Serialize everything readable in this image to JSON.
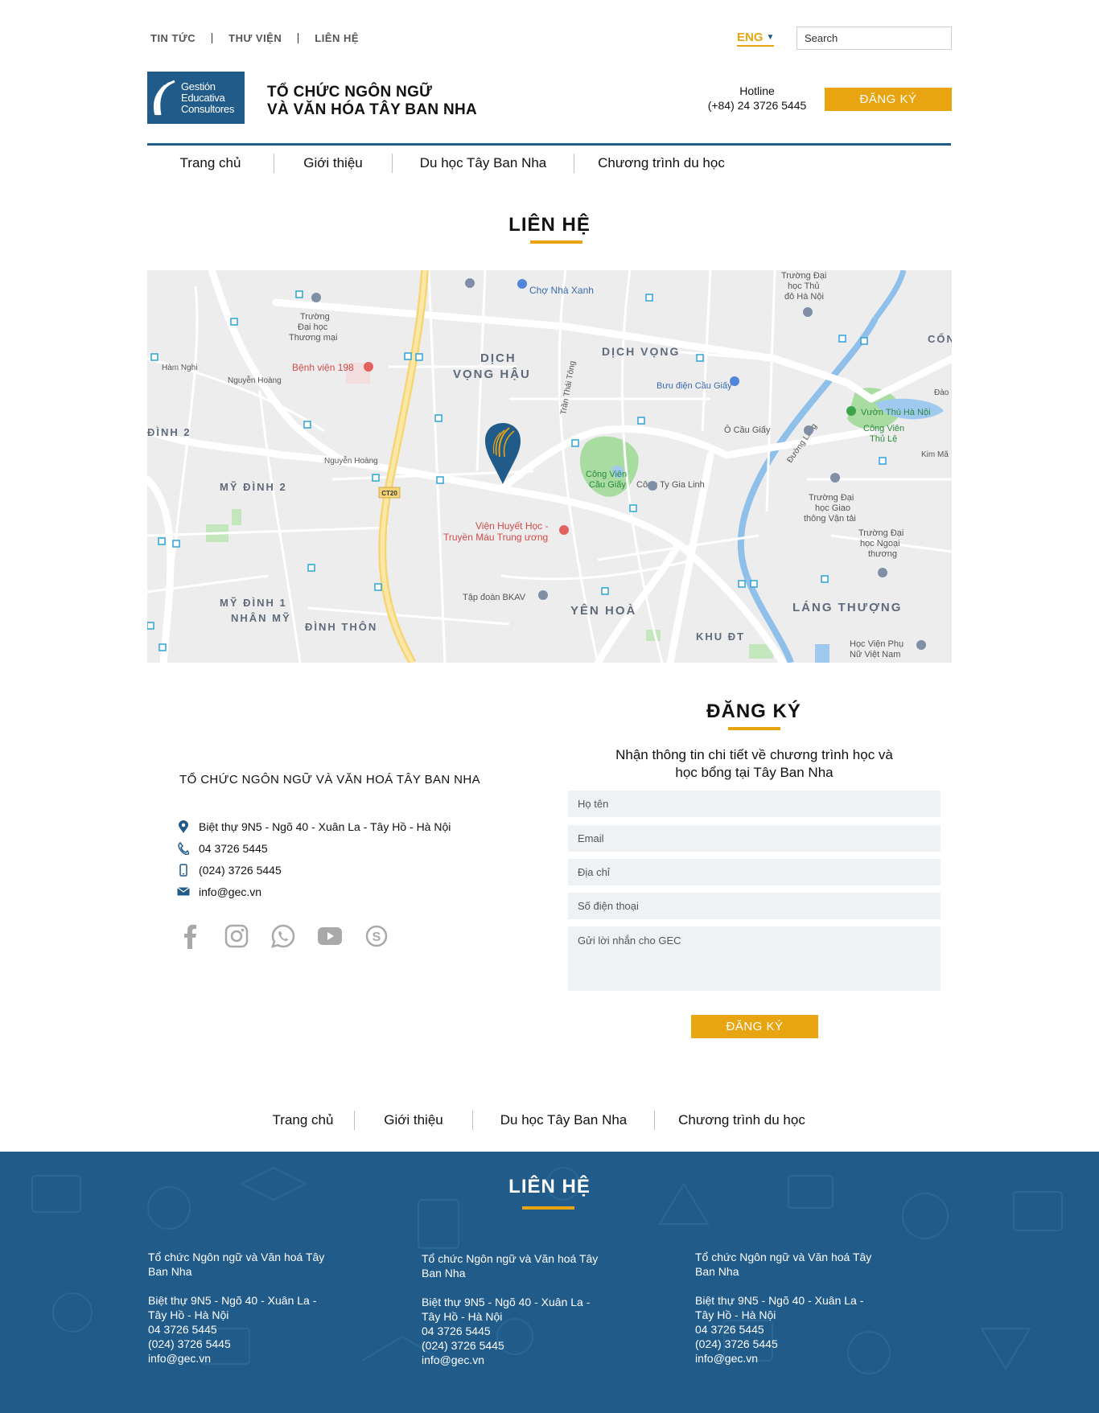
{
  "topbar": {
    "links": [
      "TIN TỨC",
      "THƯ VIỆN",
      "LIÊN HỆ"
    ],
    "language": "ENG",
    "search_placeholder": "Search"
  },
  "header": {
    "logo_lines": [
      "Gestión",
      "Educativa",
      "Consultores"
    ],
    "org_line1": "TỔ CHỨC NGÔN NGỮ",
    "org_line2": "VÀ VĂN HÓA TÂY BAN NHA",
    "hotline_label": "Hotline",
    "hotline_number": "(+84) 24 3726 5445",
    "register_button": "ĐĂNG KÝ"
  },
  "nav": [
    "Trang chủ",
    "Giới thiệu",
    "Du học Tây Ban Nha",
    "Chương trình du học"
  ],
  "page_title": "LIÊN HỆ",
  "map": {
    "labels": {
      "dich_vong_hau_1": "DỊCH",
      "dich_vong_hau_2": "VỌNG HẬU",
      "dich_vong": "DỊCH VỌNG",
      "my_dinh_2": "MỸ ĐÌNH 2",
      "my_dinh_1": "MỸ ĐÌNH 1",
      "nhan_my": "NHÂN MỸ",
      "dinh_thon": "ĐÌNH THÔN",
      "yen_hoa": "YÊN HOÀ",
      "lang_thuong": "LÁNG THƯỢNG",
      "khu_dt": "KHU ĐT",
      "dinh_2": "ĐÌNH 2",
      "cong": "CỐN",
      "cho_nha_xanh": "Chợ Nhà Xanh",
      "benh_vien": "Bệnh viện 198",
      "vien_huyet_hoc_1": "Viện Huyết Học -",
      "vien_huyet_hoc_2": "Truyền Máu Trung ương",
      "buu_dien": "Bưu điện Cầu Giấy",
      "vuon_thu": "Vườn Thú Hà Nội",
      "cong_vien_thu_le_1": "Công Viên",
      "cong_vien_thu_le_2": "Thủ Lệ",
      "cong_vien_cau_giay_1": "Công Viên",
      "cong_vien_cau_giay_2": "Cầu Giấy",
      "cong_ty_gia_linh": "Công Ty Gia Linh",
      "tap_doan_bkav": "Tập đoàn BKAV",
      "o_cau_giay": "Ô Cầu Giấy",
      "dh_thuong_mai_1": "Trường",
      "dh_thuong_mai_2": "Đại học",
      "dh_thuong_mai_3": "Thương mại",
      "dh_thu_do_1": "Trường Đại",
      "dh_thu_do_2": "học Thủ",
      "dh_thu_do_3": "đô Hà Nội",
      "dh_gtvt_1": "Trường Đại",
      "dh_gtvt_2": "học Giao",
      "dh_gtvt_3": "thông Vận tải",
      "dh_ngoai_thuong_1": "Trường Đại",
      "dh_ngoai_thuong_2": "học Ngoại",
      "dh_ngoai_thuong_3": "thương",
      "hv_phu_nu_1": "Học Viện Phụ",
      "hv_phu_nu_2": "Nữ Việt Nam",
      "ham_nghi": "Hàm Nghi",
      "nguyen_hoang": "Nguyễn Hoàng",
      "nguyen_hoang_2": "Nguyễn Hoàng",
      "ct20": "CT20",
      "tran_thai_tong": "Trần Thái Tông",
      "duong_lang": "Đường Láng",
      "kim_ma": "Kim Mã",
      "dao": "Đào"
    }
  },
  "contact": {
    "org_name": "TỔ CHỨC NGÔN NGỮ VÀ VĂN HOÁ TÂY BAN NHA",
    "address": "Biệt thự 9N5 - Ngõ 40 - Xuân La - Tây Hồ - Hà Nội",
    "phone": "04 3726 5445",
    "mobile": "(024) 3726 5445",
    "email": "info@gec.vn"
  },
  "form": {
    "title": "ĐĂNG KÝ",
    "intro_line1": "Nhận thông tin chi tiết về chương trình học và",
    "intro_line2": "học bổng tại Tây Ban Nha",
    "placeholders": {
      "name": "Họ tên",
      "email": "Email",
      "address": "Địa chỉ",
      "phone": "Số điện thoại",
      "message": "Gửi lời nhắn cho GEC"
    },
    "submit": "ĐĂNG KÝ"
  },
  "footer": {
    "title": "LIÊN HỆ",
    "columns": [
      {
        "org1": "Tổ chức Ngôn ngữ và Văn hoá Tây",
        "org2": "Ban Nha",
        "addr1": "Biệt thự 9N5 - Ngõ 40 - Xuân La -",
        "addr2": "Tây Hồ - Hà Nội",
        "phone": "04 3726 5445",
        "mobile": "(024) 3726 5445",
        "email": "info@gec.vn"
      },
      {
        "org1": "Tổ chức Ngôn ngữ và Văn hoá Tây",
        "org2": "Ban Nha",
        "addr1": "Biệt thự 9N5 - Ngõ 40 - Xuân La -",
        "addr2": "Tây Hồ - Hà Nội",
        "phone": "04 3726 5445",
        "mobile": "(024) 3726 5445",
        "email": "info@gec.vn"
      },
      {
        "org1": "Tổ chức Ngôn ngữ và Văn hoá Tây",
        "org2": "Ban Nha",
        "addr1": "Biệt thự 9N5 - Ngõ 40 - Xuân La -",
        "addr2": "Tây Hồ - Hà Nội",
        "phone": "04 3726 5445",
        "mobile": "(024) 3726 5445",
        "email": "info@gec.vn"
      }
    ]
  },
  "colors": {
    "brand_blue": "#215b8a",
    "accent_gold": "#e8a511",
    "field_bg": "#eef2f5"
  },
  "icons": [
    "map-pin-icon",
    "phone-icon",
    "mobile-icon",
    "mail-icon",
    "facebook-icon",
    "instagram-icon",
    "whatsapp-icon",
    "youtube-icon",
    "skype-icon",
    "chevron-down-icon",
    "location-marker-icon"
  ]
}
